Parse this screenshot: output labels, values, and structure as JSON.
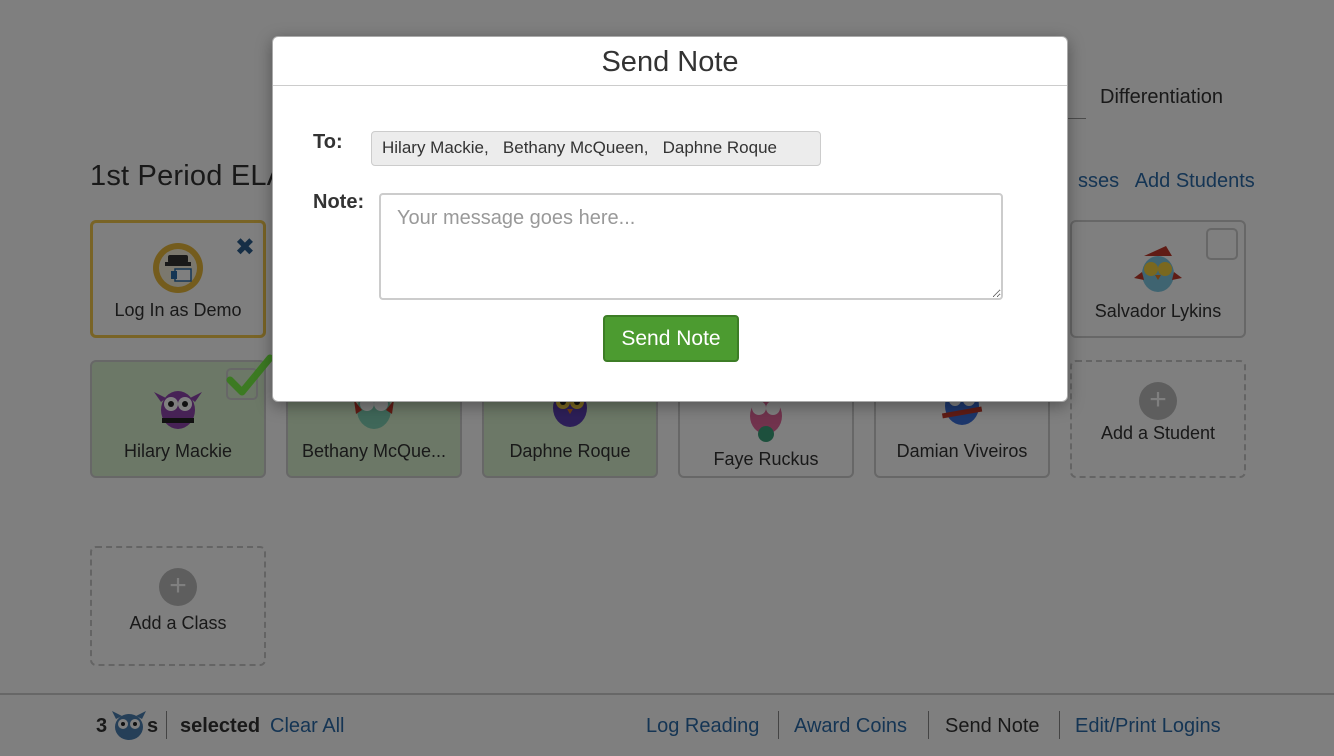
{
  "header": {
    "tab_label": "Differentiation"
  },
  "class": {
    "title": "1st Period ELA",
    "links": [
      "sses",
      "Add Students"
    ]
  },
  "students": [
    {
      "name": "Log In as Demo",
      "icon": "demo-login-icon",
      "state": "demo"
    },
    {
      "name": "Salvador Lykins",
      "icon": "owl-avatar-icon",
      "state": "unselected"
    },
    {
      "name": "Hilary Mackie",
      "icon": "owl-avatar-icon",
      "state": "selected"
    },
    {
      "name": "Bethany McQue...",
      "icon": "owl-avatar-icon",
      "state": "selected"
    },
    {
      "name": "Daphne Roque",
      "icon": "owl-avatar-icon",
      "state": "selected"
    },
    {
      "name": "Faye Ruckus",
      "icon": "owl-avatar-icon",
      "state": "unselected"
    },
    {
      "name": "Damian Viveiros",
      "icon": "owl-avatar-icon",
      "state": "unselected"
    }
  ],
  "add_student_label": "Add a Student",
  "add_class_label": "Add a Class",
  "bottom_bar": {
    "count": "3",
    "count_suffix": "s",
    "selected_label": "selected",
    "clear_all": "Clear All",
    "actions": [
      "Log Reading",
      "Award Coins",
      "Send Note",
      "Edit/Print Logins"
    ],
    "active_action": "Send Note"
  },
  "modal": {
    "title": "Send Note",
    "to_label": "To:",
    "recipients": "Hilary Mackie,   Bethany McQueen,   Daphne Roque",
    "note_label": "Note:",
    "note_placeholder": "Your message goes here...",
    "note_value": "",
    "send_button": "Send Note"
  },
  "colors": {
    "link": "#2b6aa8",
    "selected_card": "#d9f1cf",
    "send_button": "#4c9b30",
    "demo_border": "#f2c94c",
    "check": "#3c8a27"
  }
}
